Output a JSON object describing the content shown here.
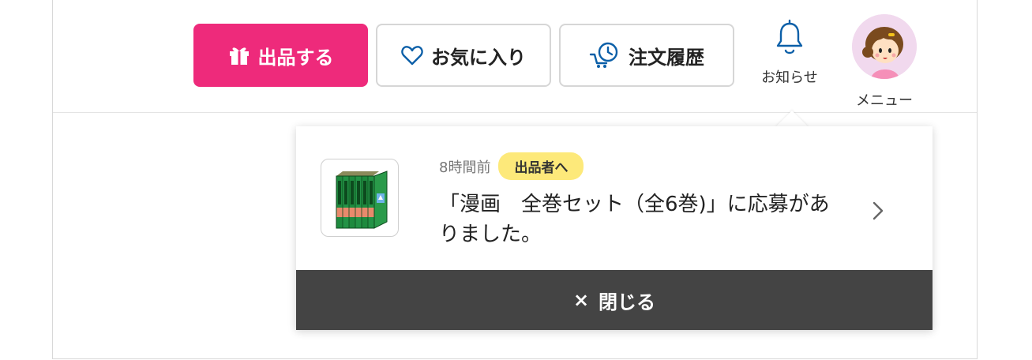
{
  "header": {
    "sell_button": {
      "label": "出品する",
      "icon": "gift-box-icon",
      "color": "#ee2a7b"
    },
    "favorites_button": {
      "label": "お気に入り",
      "icon": "heart-icon"
    },
    "order_history_button": {
      "label": "注文履歴",
      "icon": "cart-clock-icon"
    },
    "notifications": {
      "label": "お知らせ",
      "icon": "bell-icon"
    },
    "menu": {
      "label": "メニュー",
      "icon": "avatar-icon"
    }
  },
  "notification_popup": {
    "item": {
      "time": "8時間前",
      "badge": "出品者へ",
      "badge_color": "#fde97a",
      "message": "「漫画　全巻セット（全6巻)」に応募がありました。",
      "thumbnail": "manga-box-set-icon",
      "chevron": "chevron-right-icon"
    },
    "close_button": {
      "icon": "×",
      "label": "閉じる",
      "color": "#444444"
    }
  }
}
